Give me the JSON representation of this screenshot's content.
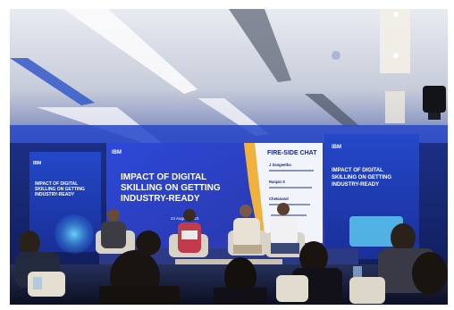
{
  "stage": {
    "brand": "IBM",
    "main_screen": {
      "title_line1": "IMPACT OF DIGITAL",
      "title_line2": "SKILLING ON GETTING",
      "title_line3": "INDUSTRY-READY",
      "date": "24 August 2023"
    },
    "side_screen_left": {
      "line1": "IMPACT OF DIGITAL",
      "line2": "SKILLING ON GETTING",
      "line3": "INDUSTRY-READY"
    },
    "side_screen_right": {
      "line1": "IMPACT OF DIGITAL",
      "line2": "SKILLING ON GETTING",
      "line3": "INDUSTRY-READY"
    },
    "fireside_panel": {
      "heading": "FIRE-SIDE CHAT",
      "speakers": [
        "J Sangeetha",
        "Ranjan S",
        "Chetanand"
      ]
    }
  },
  "colors": {
    "stage_blue": "#1f4fd6",
    "screen_blue": "#2b3fb8",
    "ceiling": "#d9dde8",
    "panel_white": "#f2f4fb"
  }
}
